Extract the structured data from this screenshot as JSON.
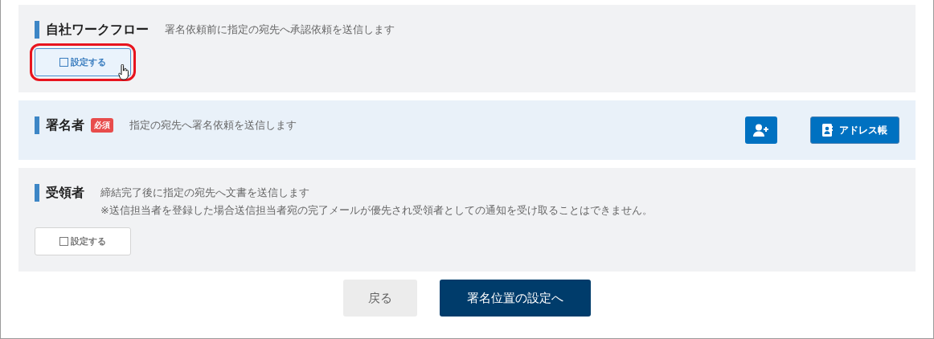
{
  "sections": [
    {
      "kind": "setting",
      "title": "自社ワークフロー",
      "required": false,
      "descriptions": [
        "署名依頼前に指定の宛先へ承認依頼を送信します"
      ],
      "button": {
        "label": "設定する",
        "highlighted": true,
        "hovered": true
      }
    },
    {
      "kind": "actions",
      "title": "署名者",
      "required": true,
      "badge": "必須",
      "descriptions": [
        "指定の宛先へ署名依頼を送信します"
      ],
      "address_button": "アドレス帳"
    },
    {
      "kind": "setting",
      "title": "受領者",
      "required": false,
      "descriptions": [
        "締結完了後に指定の宛先へ文書を送信します",
        "※送信担当者を登録した場合送信担当者宛の完了メールが優先され受領者としての通知を受け取ることはできません。"
      ],
      "button": {
        "label": "設定する",
        "highlighted": false,
        "hovered": false
      }
    }
  ],
  "footer": {
    "back": "戻る",
    "next": "署名位置の設定へ"
  }
}
